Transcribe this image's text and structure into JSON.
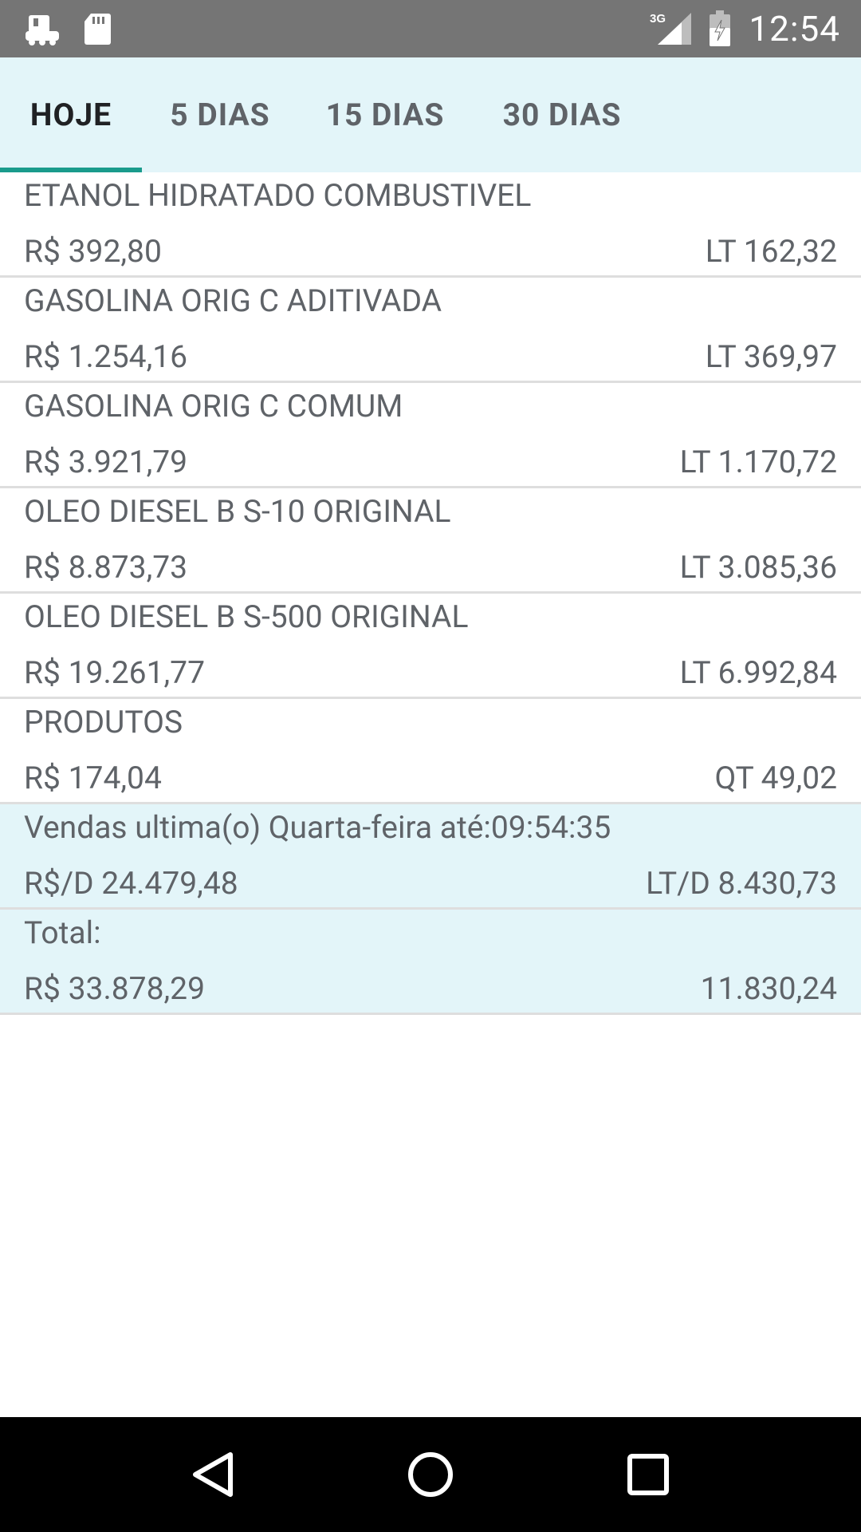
{
  "status_bar": {
    "network": "3G",
    "time": "12:54"
  },
  "tabs": [
    {
      "label": "HOJE",
      "active": true
    },
    {
      "label": "5 DIAS",
      "active": false
    },
    {
      "label": "15 DIAS",
      "active": false
    },
    {
      "label": "30 DIAS",
      "active": false
    }
  ],
  "products": [
    {
      "name": "ETANOL HIDRATADO COMBUSTIVEL",
      "amount": "R$ 392,80",
      "qty": "LT 162,32"
    },
    {
      "name": "GASOLINA ORIG C ADITIVADA",
      "amount": "R$ 1.254,16",
      "qty": "LT 369,97"
    },
    {
      "name": "GASOLINA ORIG C COMUM",
      "amount": "R$ 3.921,79",
      "qty": "LT 1.170,72"
    },
    {
      "name": "OLEO DIESEL B S-10 ORIGINAL",
      "amount": "R$ 8.873,73",
      "qty": "LT 3.085,36"
    },
    {
      "name": "OLEO DIESEL B S-500 ORIGINAL",
      "amount": "R$ 19.261,77",
      "qty": "LT 6.992,84"
    },
    {
      "name": "PRODUTOS",
      "amount": "R$ 174,04",
      "qty": "QT 49,02"
    }
  ],
  "last_sales": {
    "label": "Vendas ultima(o) Quarta-feira até:09:54:35",
    "amount": "R$/D 24.479,48",
    "qty": "LT/D 8.430,73"
  },
  "total": {
    "label": "Total:",
    "amount": "R$ 33.878,29",
    "qty": "11.830,24"
  },
  "colors": {
    "status_bar": "#757575",
    "tab_bar": "#e3f5f9",
    "tab_indicator": "#1a9b8c",
    "highlight_row": "#e3f5f9",
    "nav_bar": "#000000"
  }
}
